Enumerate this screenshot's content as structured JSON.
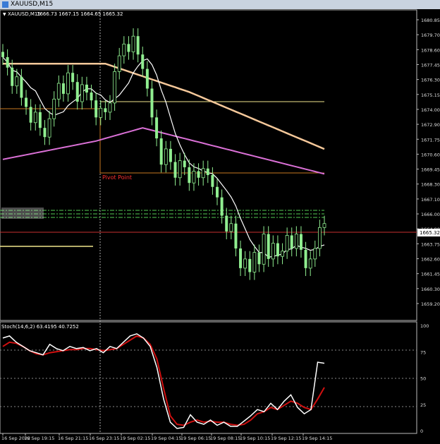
{
  "window": {
    "title": "XAUUSD,M15"
  },
  "main_chart": {
    "header_symbol": "XAUUSD,M15",
    "header_ohlc": "1666.73 1667.15 1664.65 1665.32",
    "price_labels": [
      "1680.85",
      "1679.70",
      "1678.60",
      "1677.45",
      "1676.30",
      "1675.15",
      "1674.00",
      "1672.90",
      "1671.75",
      "1670.60",
      "1669.45",
      "1668.30",
      "1667.10",
      "1666.00",
      "1664.90",
      "1663.75",
      "1662.60",
      "1661.45",
      "1660.30",
      "1659.20"
    ],
    "current_price": "1665.32",
    "pivot_label": "Pivot Point",
    "colors": {
      "bull": "#90ee90",
      "bear": "#90ee90",
      "ma_slow": "#f5c89a",
      "ma_mid": "#da70d6",
      "ma_fast": "#ffffff",
      "pivot": "#c87820",
      "pivot_text": "#ff3030",
      "level_yellow": "#f0e68c",
      "sr_lines": "#55cc55",
      "current": "#c83030"
    }
  },
  "stoch_panel": {
    "label": "Stoch(14,6,2) 63.4195 40.7252",
    "levels": [
      "100",
      "75",
      "50",
      "25",
      "0"
    ]
  },
  "time_axis": {
    "labels": [
      "16 Sep 2022",
      "16 Sep 19:15",
      "16 Sep 21:15",
      "16 Sep 23:15",
      "19 Sep 02:15",
      "19 Sep 04:15",
      "19 Sep 06:15",
      "19 Sep 08:15",
      "19 Sep 10:15",
      "19 Sep 12:15",
      "19 Sep 14:15"
    ]
  },
  "chart_data": {
    "type": "line",
    "candles_close": [
      1678.0,
      1677.2,
      1675.8,
      1676.5,
      1674.9,
      1674.2,
      1673.0,
      1673.8,
      1672.6,
      1671.9,
      1673.3,
      1674.8,
      1676.0,
      1675.2,
      1676.8,
      1676.1,
      1674.6,
      1675.9,
      1675.3,
      1674.7,
      1673.4,
      1674.1,
      1673.8,
      1674.5,
      1676.9,
      1678.1,
      1679.0,
      1678.4,
      1679.6,
      1678.2,
      1677.1,
      1675.6,
      1673.4,
      1671.8,
      1669.8,
      1671.0,
      1670.0,
      1668.8,
      1670.1,
      1669.6,
      1668.4,
      1669.3,
      1668.8,
      1669.5,
      1669.0,
      1668.1,
      1667.3,
      1665.9,
      1664.7,
      1665.3,
      1663.4,
      1661.9,
      1662.6,
      1661.6,
      1663.1,
      1662.2,
      1664.5,
      1662.6,
      1663.8,
      1662.8,
      1663.2,
      1664.4,
      1663.4,
      1664.5,
      1663.3,
      1661.9,
      1662.6,
      1663.4,
      1665.0,
      1665.3
    ],
    "stoch_main": [
      88,
      90,
      84,
      80,
      76,
      74,
      72,
      82,
      78,
      76,
      80,
      78,
      79,
      76,
      78,
      74,
      80,
      78,
      84,
      90,
      92,
      88,
      80,
      60,
      30,
      8,
      2,
      3,
      15,
      8,
      6,
      10,
      5,
      8,
      4,
      4,
      9,
      14,
      20,
      18,
      26,
      20,
      28,
      34,
      22,
      16,
      20,
      65,
      64
    ],
    "stoch_signal": [
      80,
      84,
      83,
      80,
      76,
      73,
      72,
      74,
      75,
      76,
      77,
      77,
      78,
      78,
      77,
      76,
      77,
      78,
      82,
      86,
      90,
      88,
      82,
      68,
      40,
      14,
      6,
      5,
      8,
      10,
      8,
      9,
      8,
      8,
      6,
      5,
      6,
      10,
      16,
      18,
      22,
      20,
      24,
      28,
      26,
      22,
      20,
      30,
      41
    ],
    "ylim": [
      1659.2,
      1680.85
    ]
  }
}
